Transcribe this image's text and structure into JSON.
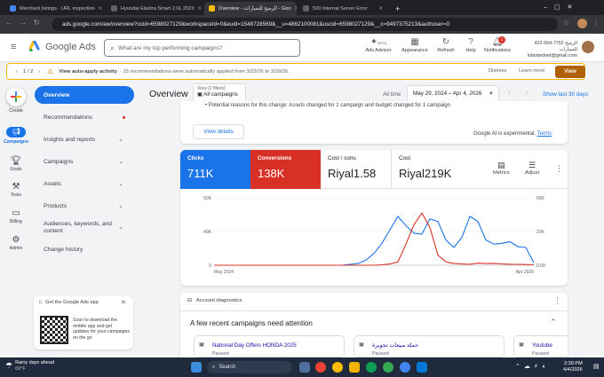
{
  "browser": {
    "tabs": [
      {
        "title": "Merchant listings - URL inspection",
        "color": "#4285f4"
      },
      {
        "title": "Hyundai Elantra Smart 2.0L 2023",
        "color": "#5f6368"
      },
      {
        "title": "Overview - الرميح للسيارات - Goo",
        "color": "#fbbc04"
      },
      {
        "title": "500 Internal Server Error",
        "color": "#5f6368"
      }
    ],
    "new_tab": "+",
    "url": "ads.google.com/aw/overview?ocid=6598027129&workspaceId=0&euid=1548728569&__u=4862100081&uscid=6598027129&__c=9497375213&authuser=0"
  },
  "header": {
    "logo": "Google Ads",
    "search_placeholder": "What are my top performing campaigns?",
    "ai_badge": "BETA",
    "buttons": [
      {
        "label": "Ads Advisor",
        "icon": "sparkle-icon"
      },
      {
        "label": "Appearance",
        "icon": "appearance-icon"
      },
      {
        "label": "Refresh",
        "icon": "refresh-icon"
      },
      {
        "label": "Help",
        "icon": "help-icon"
      },
      {
        "label": "Notifications",
        "icon": "bell-icon",
        "badge": "1"
      }
    ],
    "account_id": "422-664-7752",
    "account_name": "الرميح للسيارات",
    "account_email": "Infantedred@gmail.com"
  },
  "banner": {
    "pager": "1 / 2",
    "title": "View auto-apply activity",
    "text": "· 15 recommendations were automatically applied from 3/23/26 to 3/29/26.",
    "dismiss": "Dismiss",
    "learn": "Learn more",
    "view": "View"
  },
  "rail": [
    {
      "label": "Create",
      "icon": "plus-icon"
    },
    {
      "label": "Campaigns",
      "icon": "megaphone-icon"
    },
    {
      "label": "Goals",
      "icon": "trophy-icon"
    },
    {
      "label": "Tools",
      "icon": "wrench-icon"
    },
    {
      "label": "Billing",
      "icon": "card-icon"
    },
    {
      "label": "Admin",
      "icon": "gear-icon"
    }
  ],
  "nav": [
    {
      "label": "Overview"
    },
    {
      "label": "Recommendations"
    },
    {
      "label": "Insights and reports"
    },
    {
      "label": "Campaigns"
    },
    {
      "label": "Assets"
    },
    {
      "label": "Products"
    },
    {
      "label": "Audiences, keywords, and content"
    },
    {
      "label": "Change history"
    }
  ],
  "app_promo": {
    "title": "Get the Google Ads app",
    "text": "Scan to download the mobile app and get updates for your campaigns on the go"
  },
  "toolbar": {
    "title": "Overview",
    "filter_small": "View (2 filters)",
    "filter_label": "All campaigns",
    "all_time": "All time",
    "date_range": "May 29, 2024 – Apr 4, 2026",
    "show_last": "Show last 30 days"
  },
  "summary": {
    "fragment": "• Potential reasons for this change: Assets changed for 1 campaign and budget changed for 1 campaign",
    "view_details": "View details",
    "ai_note": "Google AI is experimental.",
    "terms": "Terms"
  },
  "metrics": [
    {
      "label": "Clicks",
      "value": "711K",
      "color": "#1a73e8"
    },
    {
      "label": "Conversions",
      "value": "138K",
      "color": "#d93025"
    },
    {
      "label": "Cost / conv.",
      "value": "Riyal1.58",
      "color": ""
    },
    {
      "label": "Cost",
      "value": "Riyal219K",
      "color": ""
    }
  ],
  "metric_tools": {
    "metrics": "Metrics",
    "adjust": "Adjust"
  },
  "chart_data": {
    "type": "line",
    "x_labels": [
      "May 2024",
      "Apr 2026"
    ],
    "left_ticks": [
      "0",
      "40K",
      "60K"
    ],
    "right_ticks": [
      "0.00",
      "20K",
      "60K"
    ],
    "series": [
      {
        "name": "Clicks",
        "color": "#1a73e8",
        "axis": "left",
        "values": [
          0,
          0,
          0,
          0,
          0,
          0,
          0,
          0,
          0,
          0,
          0,
          0,
          0,
          0,
          0,
          0,
          0,
          1000,
          2000,
          6000,
          14000,
          26000,
          42000,
          58000,
          47000,
          38000,
          37000,
          55000,
          52000,
          30000,
          21000,
          33000,
          58000,
          52000,
          30000,
          25000,
          26000,
          28000,
          22000,
          21000,
          3000
        ]
      },
      {
        "name": "Conversions",
        "color": "#d93025",
        "axis": "right",
        "values": [
          0,
          0,
          0,
          0,
          0,
          0,
          0,
          0,
          0,
          0,
          0,
          0,
          0,
          0,
          0,
          0,
          0,
          0,
          0,
          0,
          0,
          500,
          1500,
          4000,
          25000,
          48000,
          62000,
          45000,
          12000,
          4000,
          2000,
          1500,
          1000,
          2500,
          2000,
          2200,
          1500,
          1200,
          1000,
          800,
          500
        ]
      }
    ],
    "ylim_left": [
      0,
      80000
    ],
    "ylim_right": [
      0,
      80000
    ]
  },
  "diagnostics": {
    "title": "Account diagnostics",
    "heading": "A few recent campaigns need attention",
    "campaigns": [
      {
        "name": "National Day Offers HONDA 2025",
        "status": "Paused"
      },
      {
        "name": "حملة مبيعات تجويرة",
        "status": "Paused"
      },
      {
        "name": "Youtube",
        "status": "Paused"
      }
    ]
  },
  "taskbar": {
    "weather_title": "Rainy days ahead",
    "weather_temp": "69°F",
    "search": "Search",
    "time": "2:39 PM",
    "date": "4/4/2026"
  }
}
